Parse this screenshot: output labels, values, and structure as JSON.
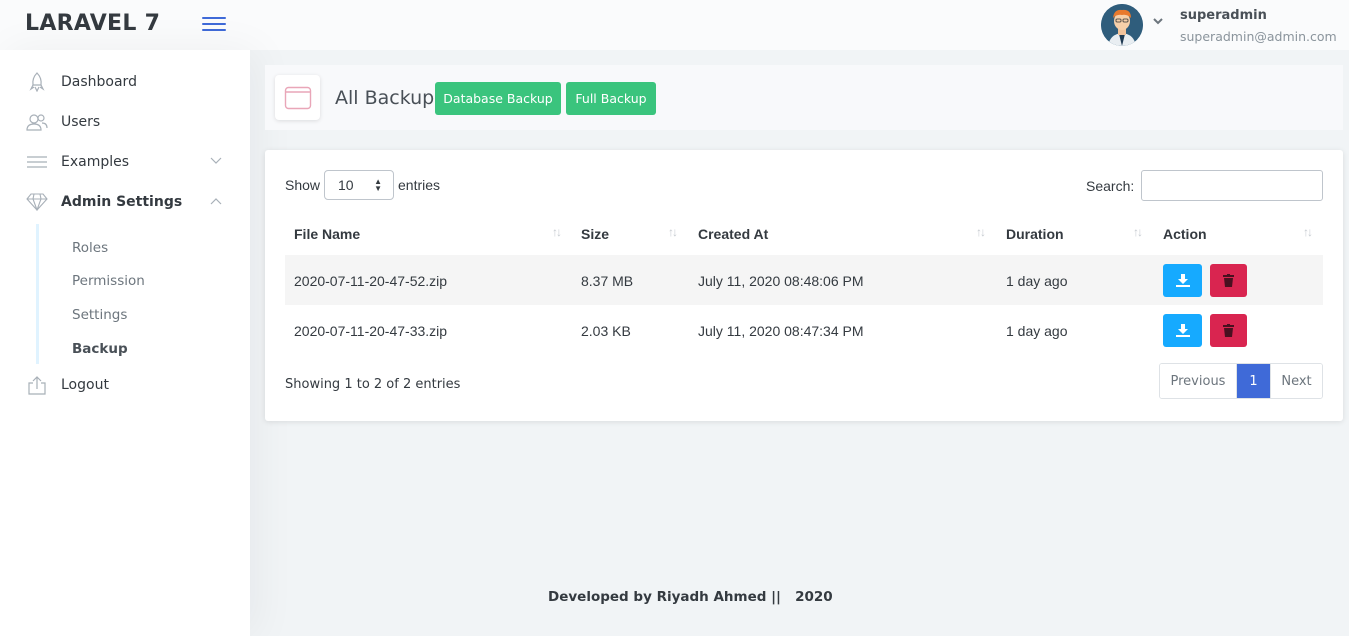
{
  "header": {
    "brand": "LARAVEL 7",
    "user_name": "superadmin",
    "user_email": "superadmin@admin.com"
  },
  "sidebar": {
    "items": [
      {
        "label": "Dashboard",
        "icon": "rocket-icon"
      },
      {
        "label": "Users",
        "icon": "users-icon"
      },
      {
        "label": "Examples",
        "icon": "list-icon"
      },
      {
        "label": "Admin Settings",
        "icon": "diamond-icon"
      },
      {
        "label": "Logout",
        "icon": "logout-icon"
      }
    ],
    "sub_items": [
      {
        "label": "Roles"
      },
      {
        "label": "Permission"
      },
      {
        "label": "Settings"
      },
      {
        "label": "Backup",
        "active": true
      }
    ]
  },
  "title_bar": {
    "title": "All Backup",
    "database_backup_label": "Database Backup",
    "full_backup_label": "Full Backup"
  },
  "table_controls": {
    "show_label": "Show",
    "page_length": "10",
    "entries_label": "entries",
    "search_label": "Search:"
  },
  "table": {
    "headers": [
      "File Name",
      "Size",
      "Created At",
      "Duration",
      "Action"
    ],
    "rows": [
      [
        "2020-07-11-20-47-52.zip",
        "8.37 MB",
        "July 11, 2020 08:48:06 PM",
        "1 day ago"
      ],
      [
        "2020-07-11-20-47-33.zip",
        "2.03 KB",
        "July 11, 2020 08:47:34 PM",
        "1 day ago"
      ]
    ]
  },
  "pagination": {
    "info": "Showing 1 to 2 of 2 entries",
    "previous": "Previous",
    "current": "1",
    "next": "Next"
  },
  "footer": {
    "text": "Developed by Riyadh Ahmed ||   2020"
  },
  "colors": {
    "primary": "#3f6ad8",
    "success": "#3ac47d",
    "info": "#16aaff",
    "danger": "#d92550"
  }
}
